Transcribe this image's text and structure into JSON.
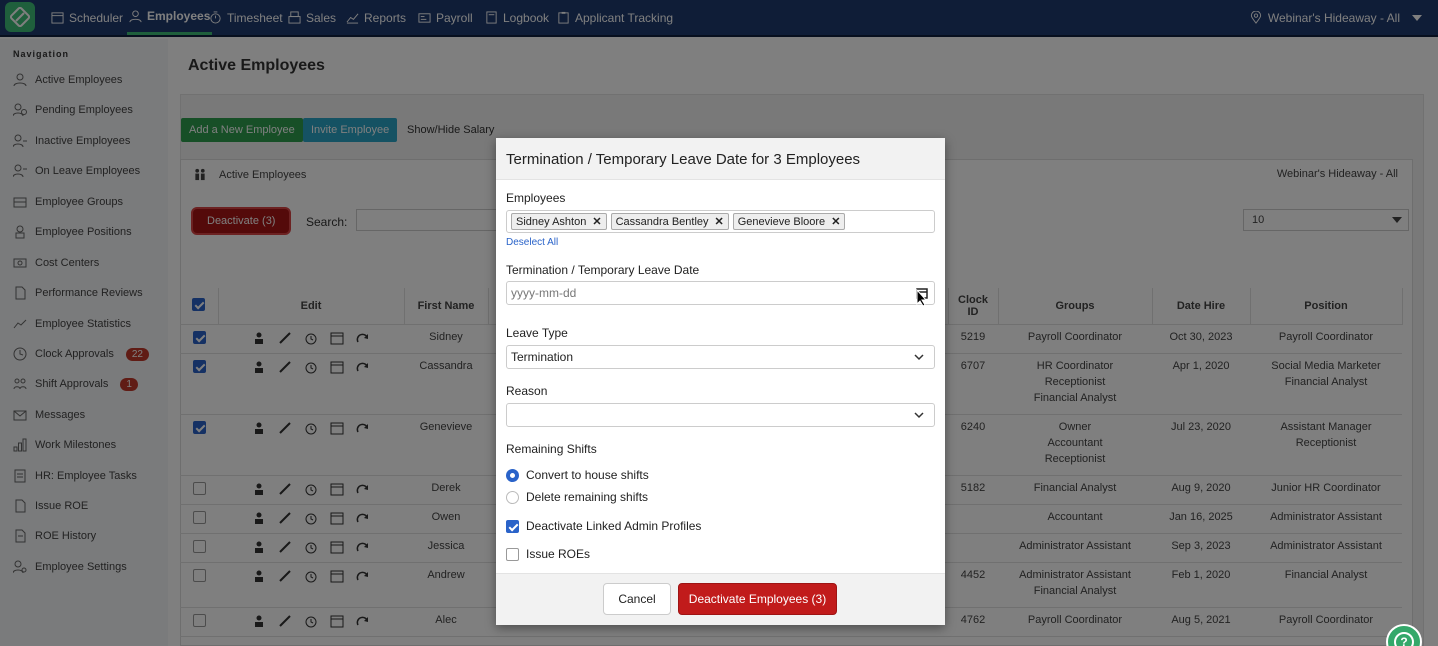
{
  "topnav": {
    "items": [
      {
        "label": "Scheduler",
        "icon": "calendar-icon"
      },
      {
        "label": "Employees",
        "icon": "person-icon",
        "active": true
      },
      {
        "label": "Timesheet",
        "icon": "stopwatch-icon"
      },
      {
        "label": "Sales",
        "icon": "register-icon"
      },
      {
        "label": "Reports",
        "icon": "chart-icon"
      },
      {
        "label": "Payroll",
        "icon": "id-card-icon"
      },
      {
        "label": "Logbook",
        "icon": "book-icon"
      },
      {
        "label": "Applicant Tracking",
        "icon": "clipboard-icon"
      }
    ],
    "location": "Webinar's Hideaway - All"
  },
  "sidebar": {
    "heading": "Navigation",
    "items": [
      {
        "label": "Active Employees"
      },
      {
        "label": "Pending Employees"
      },
      {
        "label": "Inactive Employees"
      },
      {
        "label": "On Leave Employees"
      },
      {
        "label": "Employee Groups"
      },
      {
        "label": "Employee Positions"
      },
      {
        "label": "Cost Centers"
      },
      {
        "label": "Performance Reviews"
      },
      {
        "label": "Employee Statistics"
      },
      {
        "label": "Clock Approvals",
        "badge": "22"
      },
      {
        "label": "Shift Approvals",
        "badge": "1"
      },
      {
        "label": "Messages"
      },
      {
        "label": "Work Milestones"
      },
      {
        "label": "HR: Employee Tasks"
      },
      {
        "label": "Issue ROE"
      },
      {
        "label": "ROE History"
      },
      {
        "label": "Employee Settings"
      }
    ]
  },
  "page": {
    "title": "Active Employees",
    "add_button": "Add a New Employee",
    "invite_button": "Invite Employee",
    "show_hide_salary": "Show/Hide Salary",
    "card_title": "Active Employees",
    "card_location": "Webinar's Hideaway - All",
    "deactivate_button": "Deactivate (3)",
    "search_label": "Search:",
    "page_size": "10"
  },
  "table": {
    "headers": {
      "edit": "Edit",
      "first_name": "First Name",
      "clock_id": "Clock ID",
      "groups": "Groups",
      "date_hire": "Date Hire",
      "position": "Position"
    },
    "rows": [
      {
        "checked": true,
        "first": "Sidney",
        "clock": "5219",
        "groups": [
          "Payroll Coordinator"
        ],
        "hire": "Oct 30, 2023",
        "position": [
          "Payroll Coordinator"
        ]
      },
      {
        "checked": true,
        "first": "Cassandra",
        "clock": "6707",
        "groups": [
          "HR Coordinator",
          "Receptionist",
          "Financial Analyst"
        ],
        "hire": "Apr 1, 2020",
        "position": [
          "Social Media Marketer",
          "Financial Analyst"
        ]
      },
      {
        "checked": true,
        "first": "Genevieve",
        "clock": "6240",
        "groups": [
          "Owner",
          "Accountant",
          "Receptionist"
        ],
        "hire": "Jul 23, 2020",
        "position": [
          "Assistant Manager",
          "Receptionist"
        ]
      },
      {
        "checked": false,
        "first": "Derek",
        "clock": "5182",
        "groups": [
          "Financial Analyst"
        ],
        "hire": "Aug 9, 2020",
        "position": [
          "Junior HR Coordinator"
        ]
      },
      {
        "checked": false,
        "first": "Owen",
        "clock": "",
        "groups": [
          "Accountant"
        ],
        "hire": "Jan 16, 2025",
        "position": [
          "Administrator Assistant"
        ]
      },
      {
        "checked": false,
        "first": "Jessica",
        "clock": "",
        "groups": [
          "Administrator Assistant"
        ],
        "hire": "Sep 3, 2023",
        "position": [
          "Administrator Assistant"
        ]
      },
      {
        "checked": false,
        "first": "Andrew",
        "clock": "4452",
        "groups": [
          "Administrator Assistant",
          "Financial Analyst"
        ],
        "hire": "Feb 1, 2020",
        "position": [
          "Financial Analyst"
        ]
      },
      {
        "checked": false,
        "first": "Alec",
        "clock": "4762",
        "groups": [
          "Payroll Coordinator"
        ],
        "hire": "Aug 5, 2021",
        "position": [
          "Payroll Coordinator"
        ]
      }
    ]
  },
  "modal": {
    "title": "Termination / Temporary Leave Date for 3 Employees",
    "employees_label": "Employees",
    "employees": [
      "Sidney Ashton",
      "Cassandra Bentley",
      "Genevieve Bloore"
    ],
    "deselect_all": "Deselect All",
    "date_label": "Termination / Temporary Leave Date",
    "date_placeholder": "yyyy-mm-dd",
    "leave_type_label": "Leave Type",
    "leave_type_value": "Termination",
    "reason_label": "Reason",
    "reason_value": "",
    "remaining_label": "Remaining Shifts",
    "option_convert": "Convert to house shifts",
    "option_delete": "Delete remaining shifts",
    "deactivate_linked": "Deactivate Linked Admin Profiles",
    "deactivate_linked_checked": true,
    "issue_roes": "Issue ROEs",
    "issue_roes_checked": false,
    "cancel": "Cancel",
    "submit": "Deactivate Employees (3)"
  },
  "colors": {
    "nav": "#1f3a6e",
    "accent_green": "#3fbf78",
    "danger": "#c11b1b",
    "primary": "#2a63c9"
  }
}
